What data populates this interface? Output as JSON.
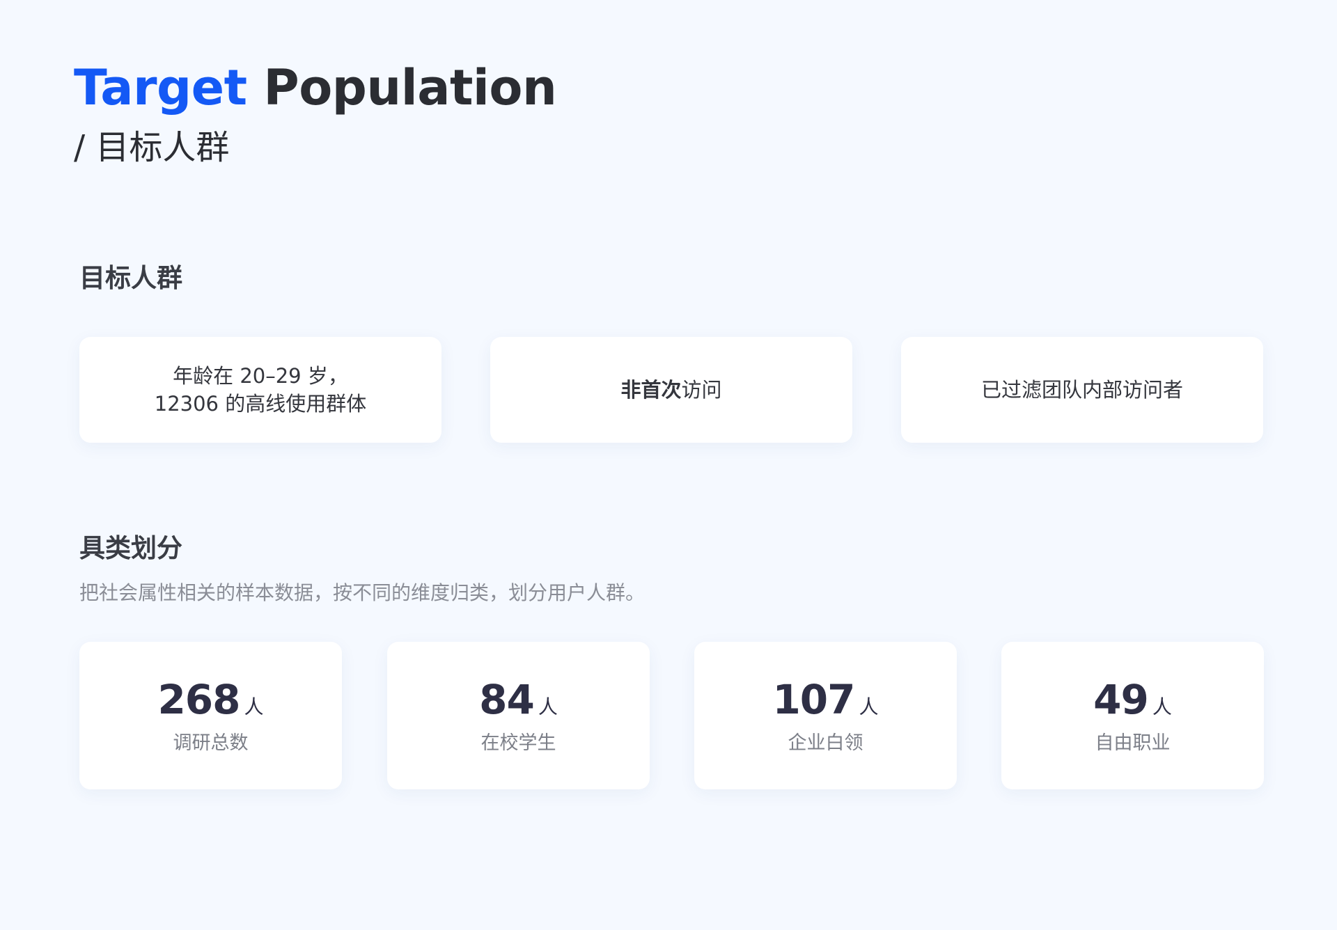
{
  "header": {
    "title_highlight": "Target",
    "title_rest": "Population",
    "subtitle": "/ 目标人群"
  },
  "colors": {
    "accent": "#1459f5",
    "background": "#f5f9ff",
    "card": "#ffffff",
    "text": "#2b2d33",
    "muted": "#8a8d96"
  },
  "target_section": {
    "title": "目标人群",
    "tags": [
      {
        "line1": "年龄在 20–29 岁，",
        "line2": "12306 的高线使用群体"
      },
      {
        "strong": "非首次",
        "normal": "访问"
      },
      {
        "text": "已过滤团队内部访问者"
      }
    ]
  },
  "segment_section": {
    "title": "具类划分",
    "description": "把社会属性相关的样本数据，按不同的维度归类，划分用户人群。",
    "stats": [
      {
        "value": "268",
        "unit": "人",
        "label": "调研总数"
      },
      {
        "value": "84",
        "unit": "人",
        "label": "在校学生"
      },
      {
        "value": "107",
        "unit": "人",
        "label": "企业白领"
      },
      {
        "value": "49",
        "unit": "人",
        "label": "自由职业"
      }
    ]
  }
}
